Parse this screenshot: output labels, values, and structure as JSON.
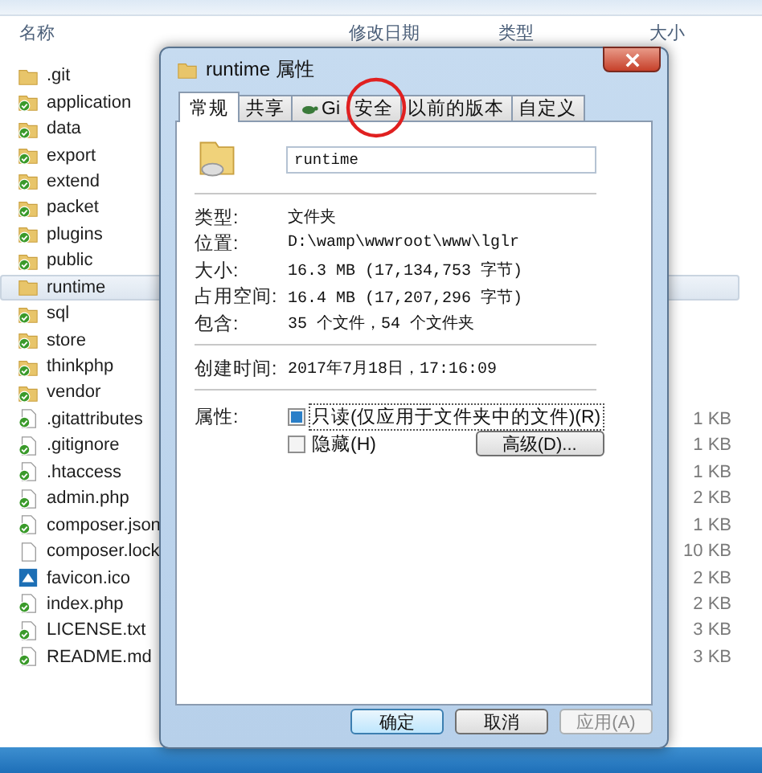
{
  "explorer": {
    "columns": [
      "名称",
      "修改日期",
      "类型",
      "大小"
    ],
    "files": [
      {
        "name": ".git",
        "kind": "folder",
        "synced": false,
        "selected": false
      },
      {
        "name": "application",
        "kind": "folder",
        "synced": true,
        "selected": false
      },
      {
        "name": "data",
        "kind": "folder",
        "synced": true,
        "selected": false
      },
      {
        "name": "export",
        "kind": "folder",
        "synced": true,
        "selected": false
      },
      {
        "name": "extend",
        "kind": "folder",
        "synced": true,
        "selected": false
      },
      {
        "name": "packet",
        "kind": "folder",
        "synced": true,
        "selected": false
      },
      {
        "name": "plugins",
        "kind": "folder",
        "synced": true,
        "selected": false
      },
      {
        "name": "public",
        "kind": "folder",
        "synced": true,
        "selected": false
      },
      {
        "name": "runtime",
        "kind": "folder",
        "synced": false,
        "selected": true
      },
      {
        "name": "sql",
        "kind": "folder",
        "synced": true,
        "selected": false
      },
      {
        "name": "store",
        "kind": "folder",
        "synced": true,
        "selected": false
      },
      {
        "name": "thinkphp",
        "kind": "folder",
        "synced": true,
        "selected": false
      },
      {
        "name": "vendor",
        "kind": "folder",
        "synced": true,
        "selected": false
      },
      {
        "name": ".gitattributes",
        "kind": "file",
        "synced": true,
        "selected": false,
        "size": "1 KB"
      },
      {
        "name": ".gitignore",
        "kind": "file",
        "synced": true,
        "selected": false,
        "size": "1 KB"
      },
      {
        "name": ".htaccess",
        "kind": "file",
        "synced": true,
        "selected": false,
        "size": "1 KB"
      },
      {
        "name": "admin.php",
        "kind": "file",
        "synced": true,
        "selected": false,
        "size": "2 KB"
      },
      {
        "name": "composer.json",
        "kind": "file",
        "synced": true,
        "selected": false,
        "size": "1 KB"
      },
      {
        "name": "composer.lock",
        "kind": "file",
        "synced": false,
        "selected": false,
        "size": "10 KB"
      },
      {
        "name": "favicon.ico",
        "kind": "image",
        "synced": false,
        "selected": false,
        "size": "2 KB"
      },
      {
        "name": "index.php",
        "kind": "file",
        "synced": true,
        "selected": false,
        "size": "2 KB"
      },
      {
        "name": "LICENSE.txt",
        "kind": "file",
        "synced": true,
        "selected": false,
        "size": "3 KB"
      },
      {
        "name": "README.md",
        "kind": "file",
        "synced": true,
        "selected": false,
        "size": "3 KB"
      }
    ]
  },
  "dialog": {
    "title": "runtime 属性",
    "tabs": [
      {
        "label": "常规",
        "selected": true,
        "kind": "text"
      },
      {
        "label": "共享",
        "selected": false,
        "kind": "text"
      },
      {
        "label": "Gi",
        "selected": false,
        "kind": "git"
      },
      {
        "label": "安全",
        "selected": false,
        "kind": "text",
        "circled": true
      },
      {
        "label": "以前的版本",
        "selected": false,
        "kind": "text"
      },
      {
        "label": "自定义",
        "selected": false,
        "kind": "text"
      }
    ],
    "name": "runtime",
    "sections": [
      [
        {
          "label": "类型:",
          "value": "文件夹"
        },
        {
          "label": "位置:",
          "value": "D:\\wamp\\wwwroot\\www\\lglr"
        },
        {
          "label": "大小:",
          "value": "16.3 MB (17,134,753 字节)"
        },
        {
          "label": "占用空间:",
          "value": "16.4 MB (17,207,296 字节)"
        },
        {
          "label": "包含:",
          "value": "35 个文件，54 个文件夹"
        }
      ],
      [
        {
          "label": "创建时间:",
          "value": "2017年7月18日，17:16:09"
        }
      ]
    ],
    "attributes_label": "属性:",
    "attributes": [
      {
        "label": "只读(仅应用于文件夹中的文件)(R)",
        "checked": false,
        "indeterminate": true,
        "focused": true
      },
      {
        "label": "隐藏(H)",
        "checked": false,
        "indeterminate": false,
        "focused": false
      }
    ],
    "advanced_button": "高级(D)...",
    "buttons": [
      {
        "label": "确定",
        "default": true,
        "disabled": false
      },
      {
        "label": "取消",
        "default": false,
        "disabled": false
      },
      {
        "label": "应用(A)",
        "default": false,
        "disabled": true
      }
    ]
  }
}
